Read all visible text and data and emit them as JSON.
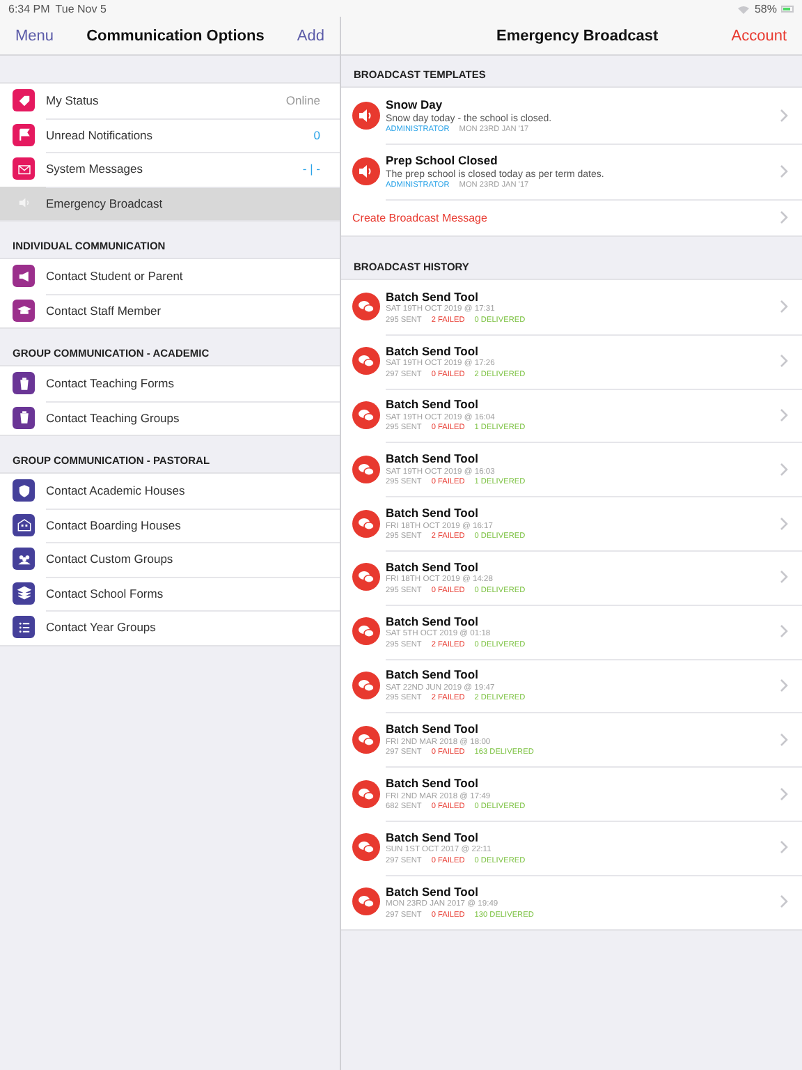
{
  "status_bar": {
    "time": "6:34 PM",
    "date": "Tue Nov 5",
    "battery": "58%"
  },
  "left_nav": {
    "menu": "Menu",
    "title": "Communication Options",
    "add": "Add"
  },
  "right_nav": {
    "title": "Emergency Broadcast",
    "account": "Account"
  },
  "sidebar": {
    "sections": [
      {
        "items": [
          {
            "label": "My Status",
            "value": "Online",
            "accent": false,
            "color": "#e5195f",
            "selected": false
          },
          {
            "label": "Unread Notifications",
            "value": "0",
            "accent": true,
            "color": "#e5195f",
            "selected": false
          },
          {
            "label": "System Messages",
            "value": "- | -",
            "accent": true,
            "color": "#e5195f",
            "selected": false
          },
          {
            "label": "Emergency Broadcast",
            "selected": true
          }
        ]
      },
      {
        "header": "INDIVIDUAL COMMUNICATION",
        "items": [
          {
            "label": "Contact Student or Parent",
            "color": "#9b2f8c",
            "selected": false
          },
          {
            "label": "Contact Staff Member",
            "color": "#9b2f8c",
            "selected": false
          }
        ]
      },
      {
        "header": "GROUP COMMUNICATION - ACADEMIC",
        "items": [
          {
            "label": "Contact Teaching Forms",
            "color": "#6a3596",
            "selected": false
          },
          {
            "label": "Contact Teaching Groups",
            "color": "#6a3596",
            "selected": false
          }
        ]
      },
      {
        "header": "GROUP COMMUNICATION - PASTORAL",
        "items": [
          {
            "label": "Contact Academic Houses",
            "color": "#45409a",
            "selected": false
          },
          {
            "label": "Contact Boarding Houses",
            "color": "#45409a",
            "selected": false
          },
          {
            "label": "Contact Custom Groups",
            "color": "#45409a",
            "selected": false
          },
          {
            "label": "Contact School Forms",
            "color": "#45409a",
            "selected": false
          },
          {
            "label": "Contact Year Groups",
            "color": "#45409a",
            "selected": false
          }
        ]
      }
    ]
  },
  "templates": {
    "header": "BROADCAST TEMPLATES",
    "items": [
      {
        "title": "Snow Day",
        "body": "Snow day today - the school is closed.",
        "author": "ADMINISTRATOR",
        "date": "MON 23RD JAN '17"
      },
      {
        "title": "Prep School Closed",
        "body": "The prep school is closed today as per term dates.",
        "author": "ADMINISTRATOR",
        "date": "MON 23RD JAN '17"
      }
    ],
    "create": "Create Broadcast Message"
  },
  "history": {
    "header": "BROADCAST HISTORY",
    "items": [
      {
        "title": "Batch Send Tool",
        "date": "SAT 19TH OCT 2019 @ 17:31",
        "sent": "295 SENT",
        "failed": "2 FAILED",
        "delivered": "0 DELIVERED"
      },
      {
        "title": "Batch Send Tool",
        "date": "SAT 19TH OCT 2019 @ 17:26",
        "sent": "297 SENT",
        "failed": "0 FAILED",
        "delivered": "2 DELIVERED"
      },
      {
        "title": "Batch Send Tool",
        "date": "SAT 19TH OCT 2019 @ 16:04",
        "sent": "295 SENT",
        "failed": "0 FAILED",
        "delivered": "1 DELIVERED"
      },
      {
        "title": "Batch Send Tool",
        "date": "SAT 19TH OCT 2019 @ 16:03",
        "sent": "295 SENT",
        "failed": "0 FAILED",
        "delivered": "1 DELIVERED"
      },
      {
        "title": "Batch Send Tool",
        "date": "FRI 18TH OCT 2019 @ 16:17",
        "sent": "295 SENT",
        "failed": "2 FAILED",
        "delivered": "0 DELIVERED"
      },
      {
        "title": "Batch Send Tool",
        "date": "FRI 18TH OCT 2019 @ 14:28",
        "sent": "295 SENT",
        "failed": "0 FAILED",
        "delivered": "0 DELIVERED"
      },
      {
        "title": "Batch Send Tool",
        "date": "SAT 5TH OCT 2019 @ 01:18",
        "sent": "295 SENT",
        "failed": "2 FAILED",
        "delivered": "0 DELIVERED"
      },
      {
        "title": "Batch Send Tool",
        "date": "SAT 22ND JUN 2019 @ 19:47",
        "sent": "295 SENT",
        "failed": "2 FAILED",
        "delivered": "2 DELIVERED"
      },
      {
        "title": "Batch Send Tool",
        "date": "FRI 2ND MAR 2018 @ 18:00",
        "sent": "297 SENT",
        "failed": "0 FAILED",
        "delivered": "163 DELIVERED"
      },
      {
        "title": "Batch Send Tool",
        "date": "FRI 2ND MAR 2018 @ 17:49",
        "sent": "682 SENT",
        "failed": "0 FAILED",
        "delivered": "0 DELIVERED"
      },
      {
        "title": "Batch Send Tool",
        "date": "SUN 1ST OCT 2017 @ 22:11",
        "sent": "297 SENT",
        "failed": "0 FAILED",
        "delivered": "0 DELIVERED"
      },
      {
        "title": "Batch Send Tool",
        "date": "MON 23RD JAN 2017 @ 19:49",
        "sent": "297 SENT",
        "failed": "0 FAILED",
        "delivered": "130 DELIVERED"
      }
    ]
  }
}
